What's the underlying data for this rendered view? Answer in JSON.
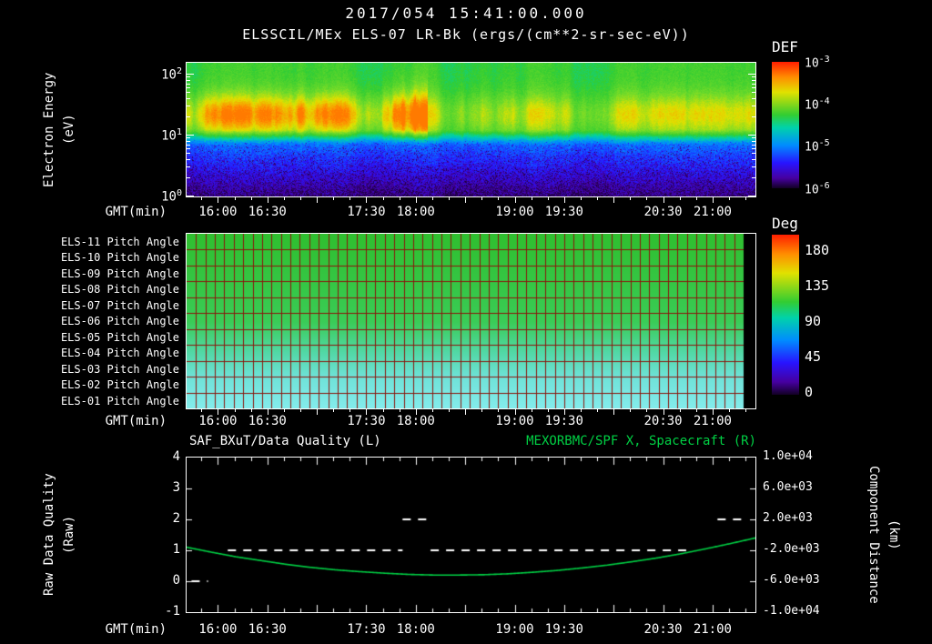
{
  "header": {
    "timestamp": "2017/054 15:41:00.000"
  },
  "accent": {
    "green": "#00d044",
    "foreground": "#ffffff",
    "background": "#000000"
  },
  "time_axis": {
    "label": "GMT(min)",
    "start_gmt": "15:41",
    "end_gmt": "21:26",
    "duration_min": 345,
    "minor_tick_step_min": 10,
    "first_minor_offset_min": 9,
    "major_tick_every_min": 30,
    "ticks": [
      {
        "label": "16:00",
        "min": 19
      },
      {
        "label": "16:30",
        "min": 49
      },
      {
        "label": "17:30",
        "min": 109
      },
      {
        "label": "18:00",
        "min": 139
      },
      {
        "label": "19:00",
        "min": 199
      },
      {
        "label": "19:30",
        "min": 229
      },
      {
        "label": "20:30",
        "min": 289
      },
      {
        "label": "21:00",
        "min": 319
      }
    ]
  },
  "spectrogram": {
    "title": "ELSSCIL/MEx ELS-07 LR-Bk  (ergs/(cm**2-sr-sec-eV))",
    "ylabel_line1": "Electron Energy",
    "ylabel_line2": "(eV)",
    "log_top": 2.2,
    "yticks": [
      {
        "base": "10",
        "exp": "2",
        "log": 2
      },
      {
        "base": "10",
        "exp": "1",
        "log": 1
      },
      {
        "base": "10",
        "exp": "0",
        "log": 0
      }
    ],
    "colorbar": {
      "label": "DEF",
      "ticks": [
        {
          "base": "10",
          "exp": "-3"
        },
        {
          "base": "10",
          "exp": "-4"
        },
        {
          "base": "10",
          "exp": "-5"
        },
        {
          "base": "10",
          "exp": "-6"
        }
      ]
    }
  },
  "pitch_panel": {
    "rows": [
      "ELS-11 Pitch Angle",
      "ELS-10 Pitch Angle",
      "ELS-09 Pitch Angle",
      "ELS-08 Pitch Angle",
      "ELS-07 Pitch Angle",
      "ELS-06 Pitch Angle",
      "ELS-05 Pitch Angle",
      "ELS-04 Pitch Angle",
      "ELS-03 Pitch Angle",
      "ELS-02 Pitch Angle",
      "ELS-01 Pitch Angle"
    ],
    "colorbar": {
      "label": "Deg",
      "ticks": [
        "180",
        "135",
        "90",
        "45",
        "0"
      ]
    },
    "grid_columns": 59,
    "data_end_frac": 0.979,
    "colors": {
      "grid": "#8b150c",
      "gradient": [
        [
          0,
          "#2fbf2f"
        ],
        [
          0.5,
          "#3acc56"
        ],
        [
          0.68,
          "#52d8a6"
        ],
        [
          0.82,
          "#6fe2d8"
        ],
        [
          1,
          "#84ecec"
        ]
      ]
    }
  },
  "quality_panel": {
    "left_title": "SAF_BXuT/Data Quality (L)",
    "right_title": "MEXORBMC/SPF X, Spacecraft (R)",
    "left_ylabel_line1": "Raw Data Quality",
    "left_ylabel_line2": "(Raw)",
    "right_ylabel_line1": "Component Distance",
    "right_ylabel_line2": "(km)",
    "left_ticks": [
      "4",
      "3",
      "2",
      "1",
      "0",
      "-1"
    ],
    "right_ticks": [
      "1.0e+04",
      "6.0e+03",
      "2.0e+03",
      "-2.0e+03",
      "-6.0e+03",
      "-1.0e+04"
    ]
  },
  "chart_data": [
    {
      "type": "heatmap",
      "panel": "electron-energy-spectrogram",
      "title": "ELSSCIL/MEx ELS-07 LR-Bk (ergs/(cm**2-sr-sec-eV))",
      "x_range_gmt": [
        "15:41",
        "21:26"
      ],
      "ylabel": "Electron Energy (eV)",
      "y_scale": "log",
      "y_range_ev": [
        1,
        158
      ],
      "value_label": "DEF",
      "value_range": [
        1e-06,
        0.001
      ],
      "colormap_stops": [
        [
          0,
          18,
          0,
          36
        ],
        [
          0.1,
          70,
          0,
          160
        ],
        [
          0.22,
          40,
          20,
          255
        ],
        [
          0.38,
          0,
          140,
          255
        ],
        [
          0.5,
          0,
          210,
          170
        ],
        [
          0.58,
          50,
          205,
          50
        ],
        [
          0.68,
          120,
          220,
          40
        ],
        [
          0.78,
          225,
          225,
          0
        ],
        [
          0.88,
          255,
          140,
          0
        ],
        [
          1,
          255,
          30,
          0
        ]
      ],
      "features": {
        "band_center_log10_ev": 1.35,
        "band_sigma_log10": 0.24,
        "background_high_energy_value": 0.58,
        "low_energy_cutoff_log10": 0.95,
        "bright_interval_gmt": [
          "15:45",
          "18:00"
        ],
        "burst_interval_gmt": [
          "17:36",
          "18:07"
        ],
        "seed": 20170541
      }
    },
    {
      "type": "heatmap",
      "panel": "pitch-angle",
      "rows": [
        "ELS-11",
        "ELS-10",
        "ELS-09",
        "ELS-08",
        "ELS-07",
        "ELS-06",
        "ELS-05",
        "ELS-04",
        "ELS-03",
        "ELS-02",
        "ELS-01"
      ],
      "value_label": "Deg",
      "value_range": [
        0,
        180
      ],
      "approx_values_deg": {
        "top_rows": 110,
        "bottom_rows": 75
      },
      "data_gap_gmt": [
        "21:19",
        "21:26"
      ]
    },
    {
      "type": "line",
      "panel": "data-quality-and-spacecraft-x",
      "x_unit": "minutes after 15:41 GMT",
      "left_axis": {
        "label": "Raw Data Quality (Raw)",
        "range": [
          -1,
          4
        ]
      },
      "right_axis": {
        "label": "Component Distance (km)",
        "range": [
          -10000,
          10000
        ]
      },
      "series": [
        {
          "name": "SAF_BXuT/Data Quality (L)",
          "axis": "left",
          "color": "#ffffff",
          "style": "dashed",
          "segments": [
            {
              "t0": 3,
              "t1": 13,
              "value": 0
            },
            {
              "t0": 25,
              "t1": 131,
              "value": 1
            },
            {
              "t0": 131,
              "t1": 146,
              "value": 2
            },
            {
              "t0": 148,
              "t1": 303,
              "value": 1
            },
            {
              "t0": 322,
              "t1": 337,
              "value": 2
            }
          ]
        },
        {
          "name": "MEXORBMC/SPF X, Spacecraft (R)",
          "axis": "left",
          "color": "#00d044",
          "style": "solid",
          "t": [
            0,
            15,
            30,
            45,
            60,
            75,
            90,
            105,
            120,
            135,
            150,
            165,
            180,
            195,
            210,
            225,
            240,
            255,
            270,
            285,
            300,
            315,
            330,
            345
          ],
          "q": [
            1.1,
            0.94,
            0.79,
            0.67,
            0.55,
            0.45,
            0.37,
            0.31,
            0.26,
            0.22,
            0.2,
            0.2,
            0.21,
            0.24,
            0.29,
            0.35,
            0.43,
            0.52,
            0.63,
            0.75,
            0.89,
            1.05,
            1.22,
            1.4
          ]
        }
      ]
    }
  ]
}
